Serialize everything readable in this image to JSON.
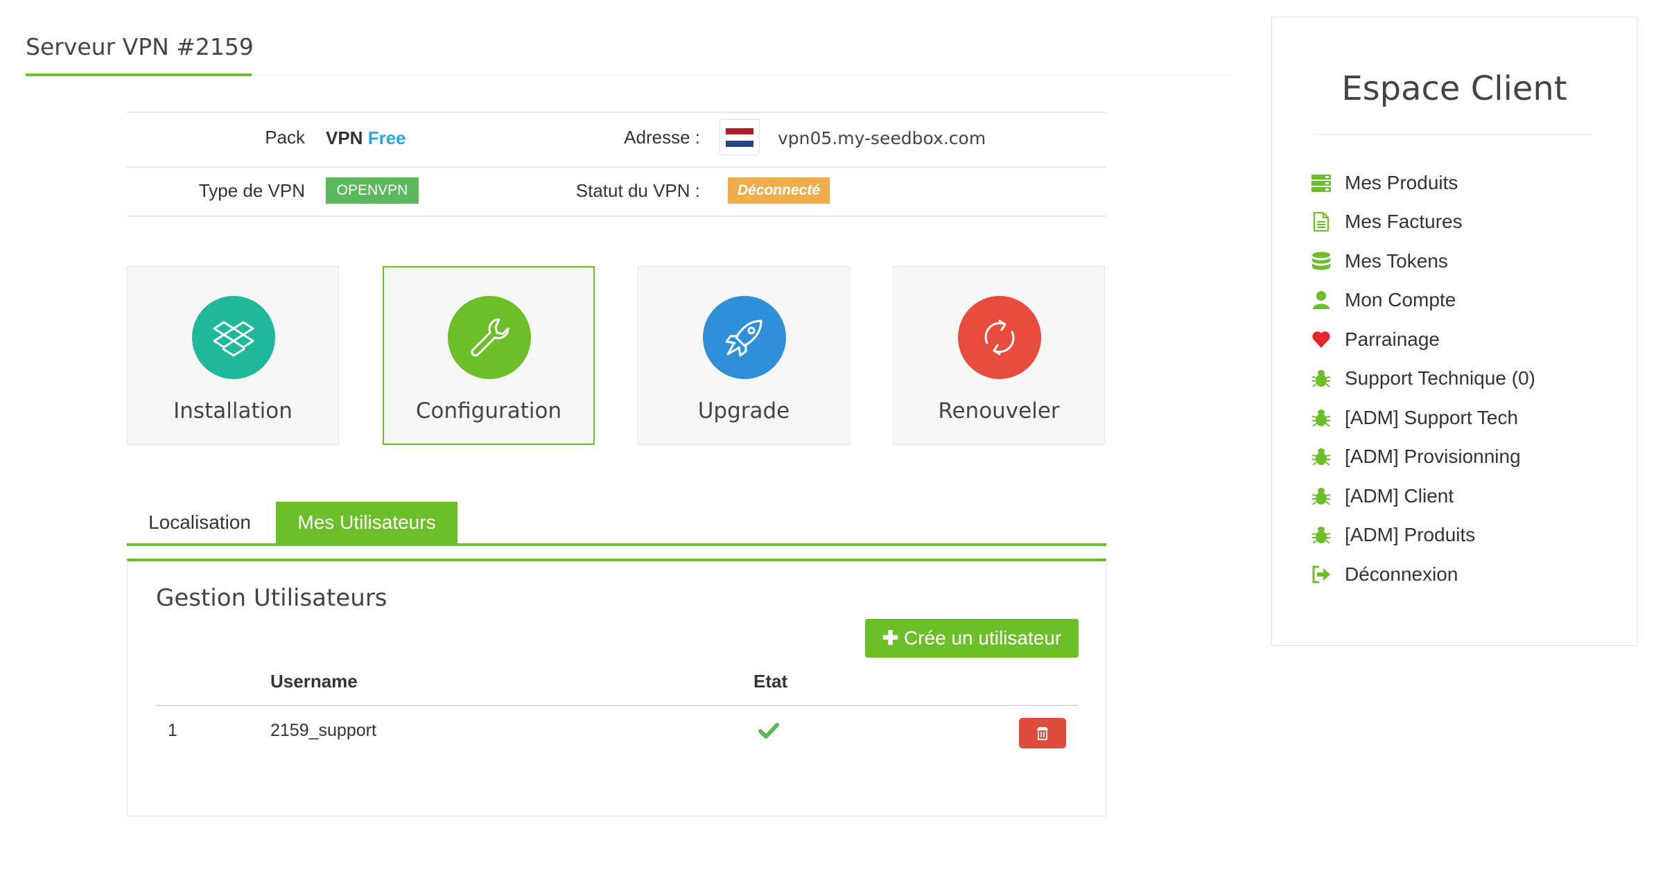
{
  "page": {
    "title": "Serveur VPN #2159"
  },
  "info": {
    "pack_label": "Pack",
    "pack_value_1": "VPN",
    "pack_value_2": "Free",
    "address_label": "Adresse :",
    "address_value": "vpn05.my-seedbox.com",
    "type_label": "Type de VPN",
    "type_value": "OPENVPN",
    "status_label": "Statut du VPN :",
    "status_value": "Déconnecté"
  },
  "tiles": [
    {
      "label": "Installation",
      "icon": "dropbox-icon",
      "color": "#1fb89a"
    },
    {
      "label": "Configuration",
      "icon": "wrench-icon",
      "color": "#6dbf2a"
    },
    {
      "label": "Upgrade",
      "icon": "rocket-icon",
      "color": "#2f8fd8"
    },
    {
      "label": "Renouveler",
      "icon": "refresh-icon",
      "color": "#e74c3c"
    }
  ],
  "tabs": [
    {
      "label": "Localisation"
    },
    {
      "label": "Mes Utilisateurs"
    }
  ],
  "users": {
    "title": "Gestion Utilisateurs",
    "create_button": "Crée un utilisateur",
    "columns": [
      "Username",
      "Etat"
    ],
    "rows": [
      {
        "index": "1",
        "username": "2159_support",
        "state": "check-icon"
      }
    ]
  },
  "sidebar": {
    "title": "Espace Client",
    "items": [
      {
        "label": "Mes Produits",
        "icon": "server-icon"
      },
      {
        "label": "Mes Factures",
        "icon": "document-icon"
      },
      {
        "label": "Mes Tokens",
        "icon": "database-icon"
      },
      {
        "label": "Mon Compte",
        "icon": "user-icon"
      },
      {
        "label": "Parrainage",
        "icon": "heart-icon"
      },
      {
        "label": "Support Technique (0)",
        "icon": "bug-icon"
      },
      {
        "label": "[ADM] Support Tech",
        "icon": "bug-icon"
      },
      {
        "label": "[ADM] Provisionning",
        "icon": "bug-icon"
      },
      {
        "label": "[ADM] Client",
        "icon": "bug-icon"
      },
      {
        "label": "[ADM] Produits",
        "icon": "bug-icon"
      },
      {
        "label": "Déconnexion",
        "icon": "sign-out-icon"
      }
    ]
  },
  "colors": {
    "accent": "#6dbf2a",
    "info": "#2aa6e0",
    "warning": "#f0ad4e",
    "danger": "#e74c3c",
    "heart": "#e8242b"
  }
}
